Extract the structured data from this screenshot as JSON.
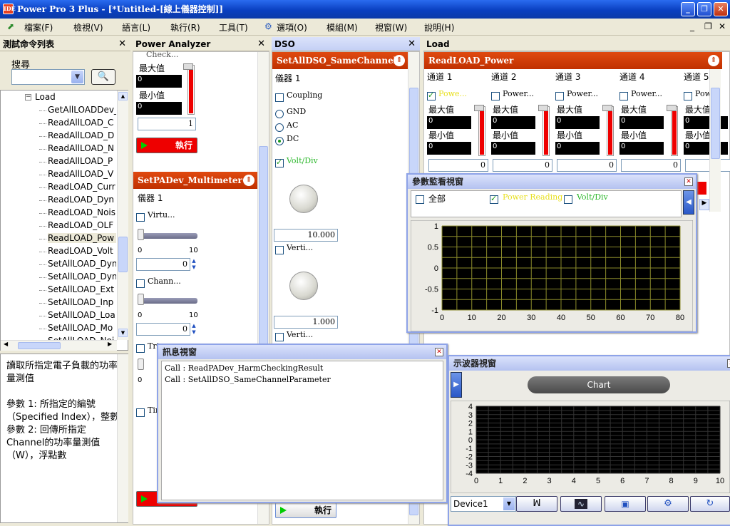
{
  "app": {
    "title": "Power Pro 3 Plus - [*Untitled-[線上儀器控制]]"
  },
  "menu": [
    "檔案(F)",
    "檢視(V)",
    "語言(L)",
    "執行(R)",
    "工具(T)",
    "選項(O)",
    "模組(M)",
    "視窗(W)",
    "說明(H)"
  ],
  "cmdlist": {
    "title": "測試命令列表",
    "search_label": "搜尋",
    "group": "Load",
    "items": [
      "GetAllLOADDev_",
      "ReadAllLOAD_C",
      "ReadAllLOAD_D",
      "ReadAllLOAD_N",
      "ReadAllLOAD_P",
      "ReadAllLOAD_V",
      "ReadLOAD_Curr",
      "ReadLOAD_Dyn",
      "ReadLOAD_Nois",
      "ReadLOAD_OLF",
      "ReadLOAD_Pow",
      "ReadLOAD_Volt",
      "SetAllLOAD_Dyn",
      "SetAllLOAD_Dyn",
      "SetAllLOAD_Ext",
      "SetAllLOAD_Inp",
      "SetAllLOAD_Loa",
      "SetAllLOAD_Mo",
      "SetAllLOAD_Noi"
    ],
    "selected_index": 10
  },
  "desc": {
    "lines": [
      "讀取所指定電子負載的功率量測值",
      "",
      "參數 1: 所指定的編號（Specified Index），整數",
      "參數 2: 回傳所指定Channel的功率量測值（W），浮點數"
    ]
  },
  "power_analyzer": {
    "title": "Power Analyzer",
    "check_label": "Check...",
    "max_label": "最大值",
    "min_label": "最小值",
    "max_val": "0",
    "min_val": "0",
    "thermo_level": 0.95,
    "num_val": "1",
    "run_label": "執行",
    "section2": "SetPADev_Multimeter···",
    "instrument": "儀器 1",
    "virtu": "Virtu...",
    "chann": "Chann...",
    "tri": "Tri",
    "tim": "Tim",
    "slider_min": "0",
    "slider_max": "10",
    "stepper1": "0",
    "stepper2": "0",
    "slider3_min": "0"
  },
  "dso": {
    "title": "DSO",
    "section": "SetAllDSO_SameChannel···",
    "instrument": "儀器 1",
    "coupling": "Coupling",
    "gnd": "GND",
    "ac": "AC",
    "dc": "DC",
    "voltdiv": "Volt/Div",
    "volt_value": "10.000",
    "verti1": "Verti...",
    "verti_value": "1.000",
    "verti2": "Verti...",
    "run_label": "執行"
  },
  "load": {
    "title": "Load",
    "section": "ReadLOAD_Power",
    "channels": [
      {
        "name": "通道 1",
        "check": "Powe...",
        "checked": true,
        "max": "0",
        "min": "0",
        "val": "0"
      },
      {
        "name": "通道 2",
        "check": "Power...",
        "checked": false,
        "max": "0",
        "min": "0",
        "val": "0"
      },
      {
        "name": "通道 3",
        "check": "Power...",
        "checked": false,
        "max": "0",
        "min": "0",
        "val": "0"
      },
      {
        "name": "通道 4",
        "check": "Power...",
        "checked": false,
        "max": "0",
        "min": "0",
        "val": "0"
      },
      {
        "name": "通道 5",
        "check": "Pow",
        "checked": false,
        "max": "0",
        "min": "0",
        "val": "0"
      }
    ],
    "max_label": "最大值",
    "min_label": "最小值"
  },
  "monitor": {
    "title": "參數監看視窗",
    "all_label": "全部",
    "power_reading": "Power Reading",
    "voltdiv": "Volt/Div",
    "power_checked": true
  },
  "info": {
    "title": "訊息視窗",
    "lines": [
      "Call : ReadPADev_HarmCheckingResult",
      "Call : SetAllDSO_SameChannelParameter"
    ]
  },
  "scope": {
    "title": "示波器視窗",
    "chart_btn": "Chart",
    "device": "Device1"
  },
  "chart_data": [
    {
      "type": "line",
      "xlim": [
        0,
        80
      ],
      "ylim": [
        -1,
        1
      ],
      "xticks": [
        "0",
        "10",
        "20",
        "30",
        "40",
        "50",
        "60",
        "70",
        "80"
      ],
      "yticks": [
        "1",
        "0.5",
        "0",
        "-0.5",
        "-1"
      ],
      "series": [],
      "grid": true
    },
    {
      "type": "line",
      "xlim": [
        0,
        10
      ],
      "ylim": [
        -4,
        4
      ],
      "xticks": [
        "0",
        "1",
        "2",
        "3",
        "4",
        "5",
        "6",
        "7",
        "8",
        "9",
        "10"
      ],
      "yticks": [
        "4",
        "3",
        "2",
        "1",
        "0",
        "-1",
        "-2",
        "-3",
        "-4"
      ],
      "series": [],
      "grid": true
    }
  ]
}
